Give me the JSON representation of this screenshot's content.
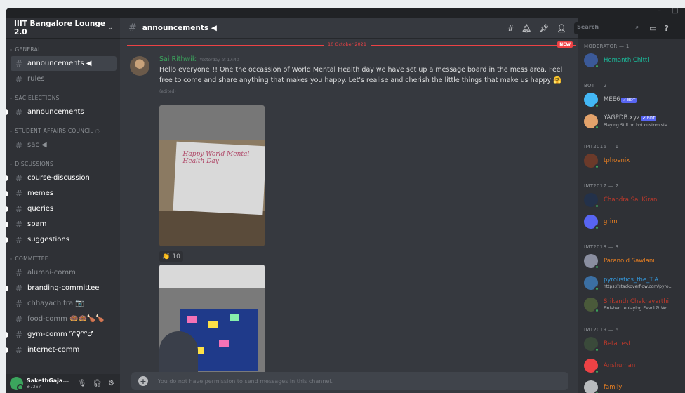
{
  "window": {
    "minimize": "–",
    "maximize": "□"
  },
  "server": {
    "name": "IIIT Bangalore Lounge 2.0",
    "chevron": "chevron-down-icon"
  },
  "categories": [
    {
      "name": "General",
      "channels": [
        {
          "name": "announcements ◀",
          "selected": true
        },
        {
          "name": "rules"
        }
      ]
    },
    {
      "name": "SAC Elections",
      "channels": [
        {
          "name": "announcements",
          "unread": true
        }
      ]
    },
    {
      "name": "Student Affairs Council ◌",
      "channels": [
        {
          "name": "sac ◀"
        }
      ]
    },
    {
      "name": "Discussions",
      "channels": [
        {
          "name": "course-discussion",
          "unread": true
        },
        {
          "name": "memes",
          "unread": true
        },
        {
          "name": "queries",
          "unread": true
        },
        {
          "name": "spam",
          "unread": true
        },
        {
          "name": "suggestions",
          "unread": true
        }
      ]
    },
    {
      "name": "Committee",
      "channels": [
        {
          "name": "alumni-comm"
        },
        {
          "name": "branding-committee",
          "unread": true
        },
        {
          "name": "chhayachitra 📷"
        },
        {
          "name": "food-comm 🍩🍩🍗🍗"
        },
        {
          "name": "gym-comm ♈♀♈♂",
          "unread": true
        },
        {
          "name": "internet-comm",
          "unread": true
        }
      ]
    }
  ],
  "user": {
    "name": "SakethGaja...",
    "tag": "#7267"
  },
  "channel_header": {
    "name": "announcements ◀",
    "search_placeholder": "Search"
  },
  "date_divider": {
    "date": "10 October 2021",
    "new_label": "NEW"
  },
  "message": {
    "author": "Sai Rithwik",
    "timestamp": "Yesterday at 17:40",
    "text": "Hello everyone!!! One the occassion of World Mental Health day we have set up a message board in the mess area. Feel free to come and share anything that makes you happy.  Let's realise and cherish the little things that make us happy 🤗",
    "edited": "(edited)",
    "reaction_emoji": "👏",
    "reaction_count": "10",
    "image1_text": "Happy World Mental Health Day"
  },
  "composer": {
    "placeholder": "You do not have permission to send messages in this channel."
  },
  "member_groups": [
    {
      "title": "MODERATOR — 1",
      "members": [
        {
          "name": "Hemanth Chitti",
          "color": "#1abc9c",
          "av": "#3b5998"
        }
      ]
    },
    {
      "title": "BOT — 2",
      "members": [
        {
          "name": "MEE6",
          "color": "#b9bbbe",
          "av": "#43b7f5",
          "bot": "✔ BOT"
        },
        {
          "name": "YAGPDB.xyz",
          "color": "#b9bbbe",
          "av": "#e3a26b",
          "bot": "✔ BOT",
          "activity": "Playing Still no bot custom sta..."
        }
      ]
    },
    {
      "title": "IMT2016 — 1",
      "members": [
        {
          "name": "tphoenix",
          "color": "#e67e22",
          "av": "#6b3a2a"
        }
      ]
    },
    {
      "title": "IMT2017 — 2",
      "members": [
        {
          "name": "Chandra Sai Kiran",
          "color": "#c0392b",
          "av": "#23314a"
        },
        {
          "name": "grim",
          "color": "#e67e22",
          "av": "#5865f2"
        }
      ]
    },
    {
      "title": "IMT2018 — 3",
      "members": [
        {
          "name": "Paranoid Sawlani",
          "color": "#e67e22",
          "av": "#8a8ea0"
        },
        {
          "name": "pyrolistics_the_T.A",
          "color": "#3498db",
          "av": "#3b6fa3",
          "activity": "https://stackoverflow.com/pyro..."
        },
        {
          "name": "Srikanth Chakravarthi",
          "color": "#c0392b",
          "av": "#4a5a3a",
          "activity": "Finished replaying Ever17! Wo..."
        }
      ]
    },
    {
      "title": "IMT2019 — 6",
      "members": [
        {
          "name": "Beta test",
          "color": "#c0392b",
          "av": "#3a4a3a"
        },
        {
          "name": "Anshuman",
          "color": "#c0392b",
          "av": "#ed4245"
        },
        {
          "name": "family",
          "color": "#e67e22",
          "av": "#b9bbbe"
        }
      ]
    }
  ]
}
